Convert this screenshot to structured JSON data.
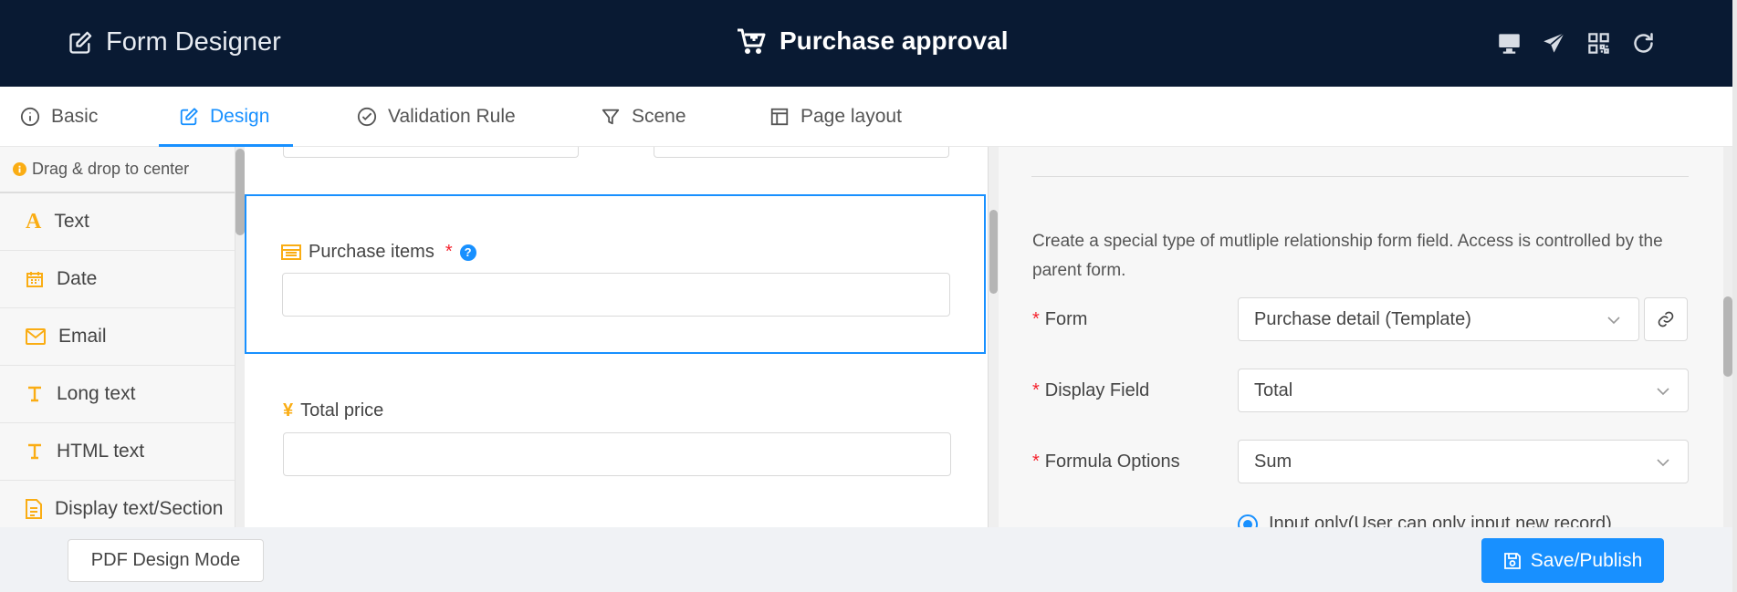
{
  "header": {
    "app_title": "Form Designer",
    "form_title": "Purchase approval",
    "icons": [
      "desktop-icon",
      "send-icon",
      "qrcode-icon",
      "refresh-icon"
    ]
  },
  "tabs": [
    {
      "label": "Basic",
      "icon": "info-icon",
      "active": false
    },
    {
      "label": "Design",
      "icon": "edit-icon",
      "active": true
    },
    {
      "label": "Validation Rule",
      "icon": "check-circle-icon",
      "active": false
    },
    {
      "label": "Scene",
      "icon": "filter-icon",
      "active": false
    },
    {
      "label": "Page layout",
      "icon": "layout-icon",
      "active": false
    }
  ],
  "sidebar": {
    "hint": "Drag & drop to center",
    "items": [
      {
        "label": "Text",
        "icon": "text-icon"
      },
      {
        "label": "Date",
        "icon": "calendar-icon"
      },
      {
        "label": "Email",
        "icon": "mail-icon"
      },
      {
        "label": "Long text",
        "icon": "long-text-icon"
      },
      {
        "label": "HTML text",
        "icon": "html-text-icon"
      },
      {
        "label": "Display text/Section",
        "icon": "file-text-icon"
      }
    ]
  },
  "canvas": {
    "fields": [
      {
        "label": "Purchase items",
        "required": "*",
        "icon": "table-icon",
        "help": "?"
      },
      {
        "label": "Total price",
        "icon": "yen-icon",
        "icon_glyph": "¥"
      }
    ]
  },
  "properties": {
    "description": "Create a special type of mutliple relationship form field. Access is controlled by the parent form.",
    "form_label": "Form",
    "form_value": "Purchase detail (Template)",
    "display_field_label": "Display Field",
    "display_field_value": "Total",
    "formula_label": "Formula Options",
    "formula_value": "Sum",
    "radio_option": "Input only(User can only input new record)",
    "required_mark": "*"
  },
  "footer": {
    "pdf_button": "PDF Design Mode",
    "save_button": "Save/Publish"
  },
  "colors": {
    "header_bg": "#091a33",
    "accent": "#1890ff",
    "icon_orange": "#faad14",
    "required_red": "#f5222d"
  }
}
